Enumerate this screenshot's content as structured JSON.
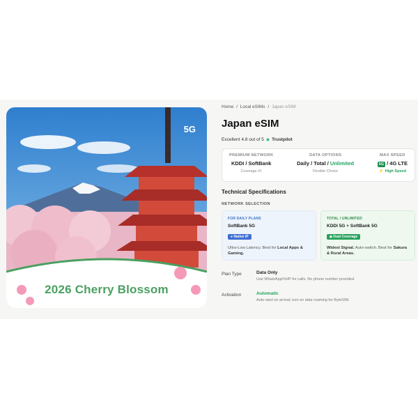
{
  "breadcrumb": {
    "home": "Home",
    "local": "Local eSIMs",
    "current": "Japan eSIM",
    "separator": "/"
  },
  "product": {
    "title": "Japan eSIM"
  },
  "rating": {
    "label": "Excellent",
    "score_text": "4.8 out of 5",
    "brand": "Trustpilot"
  },
  "hero": {
    "badge": "5G",
    "caption": "2026 Cherry Blossom"
  },
  "specs": {
    "network": {
      "header": "PREMIUM NETWORK",
      "value": "KDDI / SoftBank",
      "sub": "Coverage #1"
    },
    "data": {
      "header": "DATA OPTIONS",
      "value_part1": "Daily / Total / ",
      "value_part2": "Unlimited",
      "sub": "Flexible Choice"
    },
    "speed": {
      "header": "MAX SPEED",
      "tag": "5G",
      "value": "/ 4G LTE",
      "sub": "High Speed"
    }
  },
  "tech": {
    "title": "Technical Specifications",
    "network_selection": "NETWORK SELECTION",
    "daily": {
      "header": "FOR DAILY PLANS",
      "title": "SoftBank 5G",
      "pill": "Native IP",
      "desc_plain": "Ultra-Low Latency. Best for ",
      "desc_bold": "Local Apps & Gaming."
    },
    "total": {
      "header": "TOTAL / UNLIMITED",
      "title": "KDDI 5G + SoftBank 5G",
      "pill": "Dual Coverage",
      "desc_bold1": "Widest Signal.",
      "desc_plain": " Auto-switch. Best for ",
      "desc_bold2": "Sakura & Rural Areas."
    }
  },
  "details": [
    {
      "key": "Plan Type",
      "value": "Data Only",
      "sub": "Use WhatsApp/VoIP for calls. No phone number provided."
    },
    {
      "key": "Activation",
      "value": "Automatic",
      "sub": "Auto-start on arrival; turn on data roaming for ByteSIM."
    }
  ],
  "colors": {
    "accent_green": "#1fa35f",
    "blue": "#3f6fd2",
    "sky": "#3d8fd6",
    "pagoda_red": "#c0392b"
  }
}
